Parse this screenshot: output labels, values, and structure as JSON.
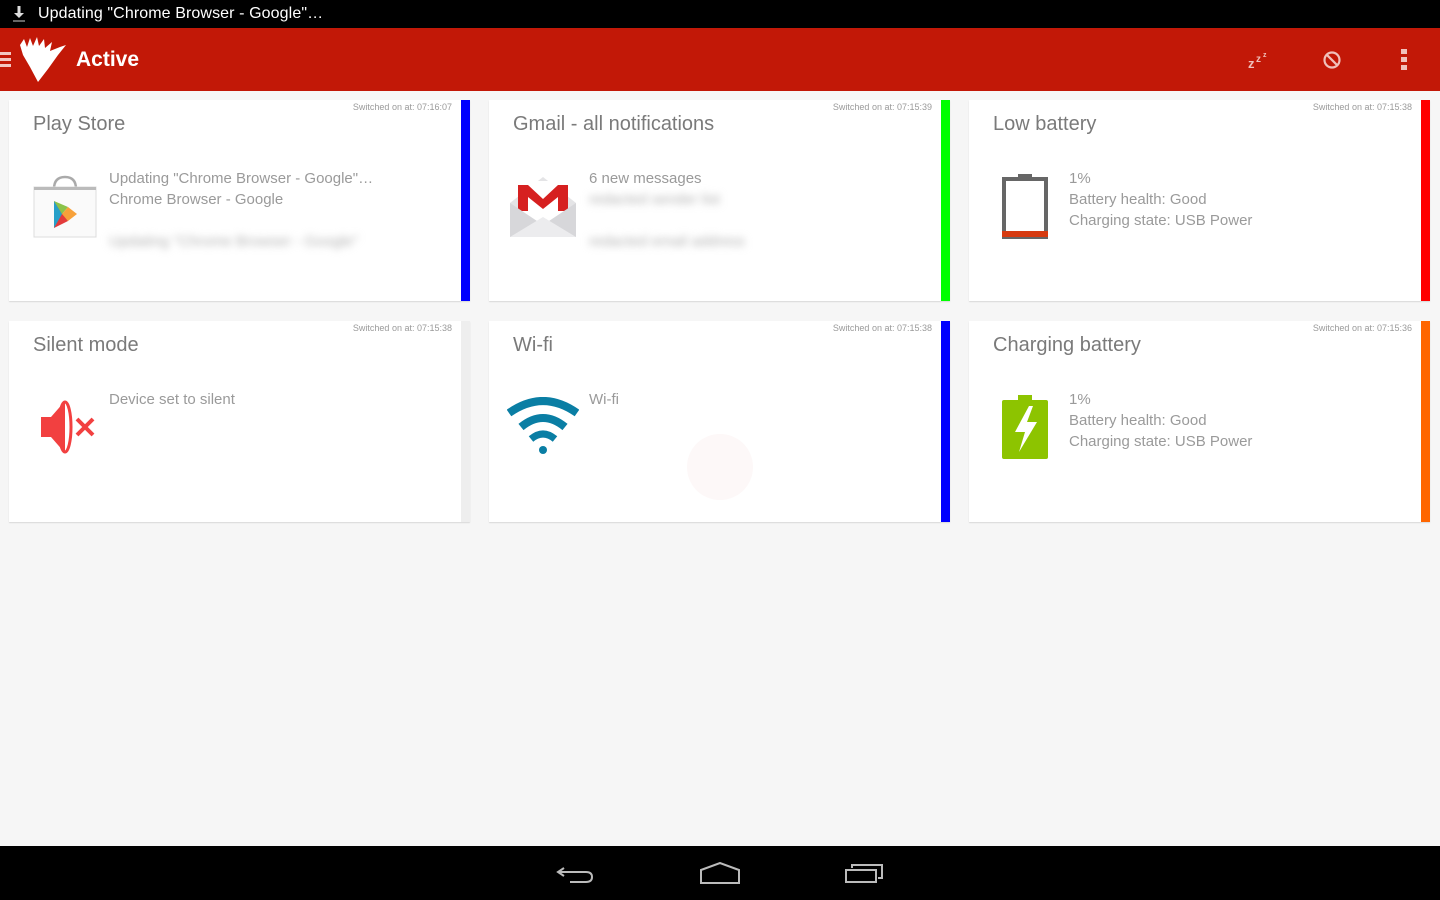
{
  "status_bar": {
    "notification_text": "Updating \"Chrome Browser - Google\"…",
    "icon": "download-icon"
  },
  "action_bar": {
    "title": "Active",
    "background_color": "#c21807",
    "actions": [
      {
        "name": "snooze",
        "icon": "snooze-icon"
      },
      {
        "name": "block",
        "icon": "block-icon"
      },
      {
        "name": "overflow",
        "icon": "overflow-menu-icon"
      }
    ]
  },
  "cards": [
    {
      "title": "Play Store",
      "timestamp": "Switched on at: 07:16:07",
      "bar_color": "#0000ff",
      "icon": "play-store-icon",
      "lines": [
        "Updating \"Chrome Browser - Google\"…",
        "Chrome Browser - Google"
      ],
      "blurred_lines": [
        "Updating \"Chrome Browser - Google\""
      ]
    },
    {
      "title": "Gmail - all notifications",
      "timestamp": "Switched on at: 07:15:39",
      "bar_color": "#00ff00",
      "icon": "gmail-icon",
      "lines": [
        "6 new messages"
      ],
      "blurred_lines": [
        "redacted sender list",
        "redacted email address"
      ]
    },
    {
      "title": "Low battery",
      "timestamp": "Switched on at: 07:15:38",
      "bar_color": "#ff0000",
      "icon": "battery-low-icon",
      "lines": [
        "1%",
        "Battery health: Good",
        "Charging state: USB Power"
      ],
      "blurred_lines": []
    },
    {
      "title": "Silent mode",
      "timestamp": "Switched on at: 07:15:38",
      "bar_color": "#eeeeee",
      "icon": "volume-muted-icon",
      "lines": [
        "Device set to silent"
      ],
      "blurred_lines": []
    },
    {
      "title": "Wi-fi",
      "timestamp": "Switched on at: 07:15:38",
      "bar_color": "#0000ff",
      "icon": "wifi-icon",
      "lines": [
        "Wi-fi"
      ],
      "blurred_lines": []
    },
    {
      "title": "Charging battery",
      "timestamp": "Switched on at: 07:15:36",
      "bar_color": "#ff6600",
      "icon": "battery-charging-icon",
      "lines": [
        "1%",
        "Battery health: Good",
        "Charging state: USB Power"
      ],
      "blurred_lines": []
    }
  ],
  "nav_bar": {
    "buttons": [
      {
        "name": "back",
        "icon": "back-icon"
      },
      {
        "name": "home",
        "icon": "home-icon"
      },
      {
        "name": "recents",
        "icon": "recents-icon"
      }
    ]
  }
}
